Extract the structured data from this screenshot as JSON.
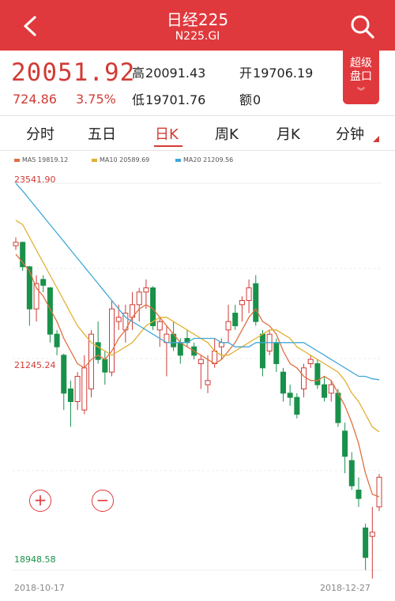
{
  "header": {
    "title": "日经225",
    "subtitle": "N225.GI",
    "back_icon": "chevron-left-icon",
    "search_icon": "search-icon",
    "bg_color": "#e0393d"
  },
  "quote": {
    "price": "20051.92",
    "change": "724.86",
    "change_pct": "3.75%",
    "high_label": "高",
    "high": "20091.43",
    "open_label": "开",
    "open": "19706.19",
    "low_label": "低",
    "low": "19701.76",
    "amount_label": "额",
    "amount": "0",
    "badge": [
      "超级",
      "盘口"
    ],
    "color_up": "#d13b36"
  },
  "tabs": [
    {
      "label": "分时",
      "active": false
    },
    {
      "label": "五日",
      "active": false
    },
    {
      "label": "日K",
      "active": true
    },
    {
      "label": "周K",
      "active": false
    },
    {
      "label": "月K",
      "active": false
    },
    {
      "label": "分钟",
      "active": false
    }
  ],
  "legend": [
    {
      "label": "MA5 19819.12",
      "color": "#e07040"
    },
    {
      "label": "MA10 20589.69",
      "color": "#e0b030"
    },
    {
      "label": "MA20 21209.56",
      "color": "#40a8d8"
    }
  ],
  "chart_data": {
    "type": "candlestick",
    "y_max_label": "23541.90",
    "y_mid_label": "21245.24",
    "y_min_label": "18948.58",
    "ylim": [
      18948.58,
      23541.9
    ],
    "x_start": "2018-10-17",
    "x_end": "2018-12-27",
    "up_color": "#d13b36",
    "down_color": "#19914a",
    "candles": [
      [
        22800,
        22900,
        22750,
        22840
      ],
      [
        22840,
        22850,
        22500,
        22550
      ],
      [
        22550,
        22560,
        21850,
        22050
      ],
      [
        22050,
        22450,
        21900,
        22350
      ],
      [
        22400,
        22450,
        22250,
        22330
      ],
      [
        22300,
        22310,
        21650,
        21750
      ],
      [
        21750,
        21800,
        21500,
        21600
      ],
      [
        21500,
        21520,
        20850,
        21050
      ],
      [
        21100,
        21200,
        20650,
        20950
      ],
      [
        20950,
        21300,
        20850,
        21250
      ],
      [
        20850,
        21500,
        20800,
        21350
      ],
      [
        21100,
        21800,
        21000,
        21750
      ],
      [
        21650,
        21900,
        21400,
        21450
      ],
      [
        21450,
        21550,
        21150,
        21300
      ],
      [
        21300,
        22150,
        21250,
        22050
      ],
      [
        21900,
        22100,
        21800,
        21950
      ],
      [
        21800,
        22100,
        21650,
        22000
      ],
      [
        21950,
        22250,
        21800,
        22100
      ],
      [
        22100,
        22300,
        21900,
        22250
      ],
      [
        22250,
        22400,
        22050,
        22300
      ],
      [
        22300,
        22320,
        21800,
        21850
      ],
      [
        21800,
        21950,
        21600,
        21900
      ],
      [
        21650,
        21850,
        21250,
        21750
      ],
      [
        21750,
        21900,
        21550,
        21600
      ],
      [
        21650,
        21700,
        21400,
        21500
      ],
      [
        21700,
        21800,
        21600,
        21650
      ],
      [
        21600,
        21650,
        21450,
        21500
      ],
      [
        21400,
        21500,
        21100,
        21450
      ],
      [
        21150,
        21500,
        21050,
        21200
      ],
      [
        21400,
        21700,
        21350,
        21550
      ],
      [
        21600,
        21700,
        21450,
        21650
      ],
      [
        21800,
        22100,
        21650,
        21900
      ],
      [
        22000,
        22100,
        21800,
        21850
      ],
      [
        22100,
        22200,
        21900,
        22150
      ],
      [
        22150,
        22400,
        22000,
        22300
      ],
      [
        22350,
        22450,
        21850,
        21900
      ],
      [
        21750,
        21800,
        21250,
        21350
      ],
      [
        21550,
        21800,
        21500,
        21750
      ],
      [
        21650,
        21700,
        21300,
        21400
      ],
      [
        21300,
        21350,
        20950,
        21050
      ],
      [
        21050,
        21150,
        20900,
        21000
      ],
      [
        21000,
        21050,
        20750,
        20800
      ],
      [
        21100,
        21400,
        21000,
        21350
      ],
      [
        21400,
        21500,
        21350,
        21450
      ],
      [
        21400,
        21450,
        21100,
        21150
      ],
      [
        21150,
        21250,
        20950,
        21000
      ],
      [
        21050,
        21200,
        20950,
        21150
      ],
      [
        21050,
        21100,
        20650,
        20700
      ],
      [
        20600,
        20700,
        20100,
        20300
      ],
      [
        20250,
        20350,
        19900,
        19950
      ],
      [
        19900,
        20050,
        19700,
        19800
      ],
      [
        19450,
        19500,
        18950,
        19100
      ],
      [
        19350,
        19700,
        18850,
        19400
      ],
      [
        19700,
        20091,
        19650,
        20052
      ]
    ],
    "ma5": [
      22700,
      22600,
      22500,
      22300,
      22200,
      22050,
      21900,
      21700,
      21550,
      21400,
      21350,
      21450,
      21500,
      21450,
      21550,
      21700,
      21800,
      21950,
      22050,
      22100,
      22050,
      21950,
      21850,
      21750,
      21650,
      21600,
      21550,
      21500,
      21450,
      21400,
      21450,
      21550,
      21650,
      21800,
      21950,
      22050,
      21900,
      21850,
      21750,
      21550,
      21400,
      21350,
      21250,
      21200,
      21200,
      21250,
      21200,
      21050,
      20900,
      20700,
      20450,
      20100,
      19850,
      19819
    ],
    "ma10": [
      23100,
      23050,
      22900,
      22750,
      22600,
      22450,
      22300,
      22150,
      22000,
      21850,
      21750,
      21650,
      21600,
      21550,
      21500,
      21550,
      21600,
      21650,
      21750,
      21850,
      21900,
      21950,
      21950,
      21900,
      21850,
      21800,
      21750,
      21700,
      21650,
      21550,
      21500,
      21500,
      21550,
      21600,
      21650,
      21700,
      21750,
      21800,
      21800,
      21750,
      21700,
      21600,
      21550,
      21500,
      21450,
      21400,
      21350,
      21300,
      21200,
      21050,
      20950,
      20800,
      20650,
      20590
    ],
    "ma20": [
      23541,
      23450,
      23350,
      23250,
      23150,
      23050,
      22950,
      22850,
      22750,
      22650,
      22550,
      22450,
      22350,
      22250,
      22150,
      22050,
      21950,
      21900,
      21850,
      21800,
      21750,
      21700,
      21650,
      21650,
      21650,
      21650,
      21700,
      21700,
      21700,
      21700,
      21650,
      21650,
      21600,
      21600,
      21600,
      21650,
      21650,
      21650,
      21650,
      21650,
      21650,
      21650,
      21650,
      21600,
      21550,
      21500,
      21450,
      21400,
      21350,
      21300,
      21250,
      21250,
      21220,
      21210
    ]
  },
  "zoom": {
    "in": "+",
    "out": "−"
  }
}
